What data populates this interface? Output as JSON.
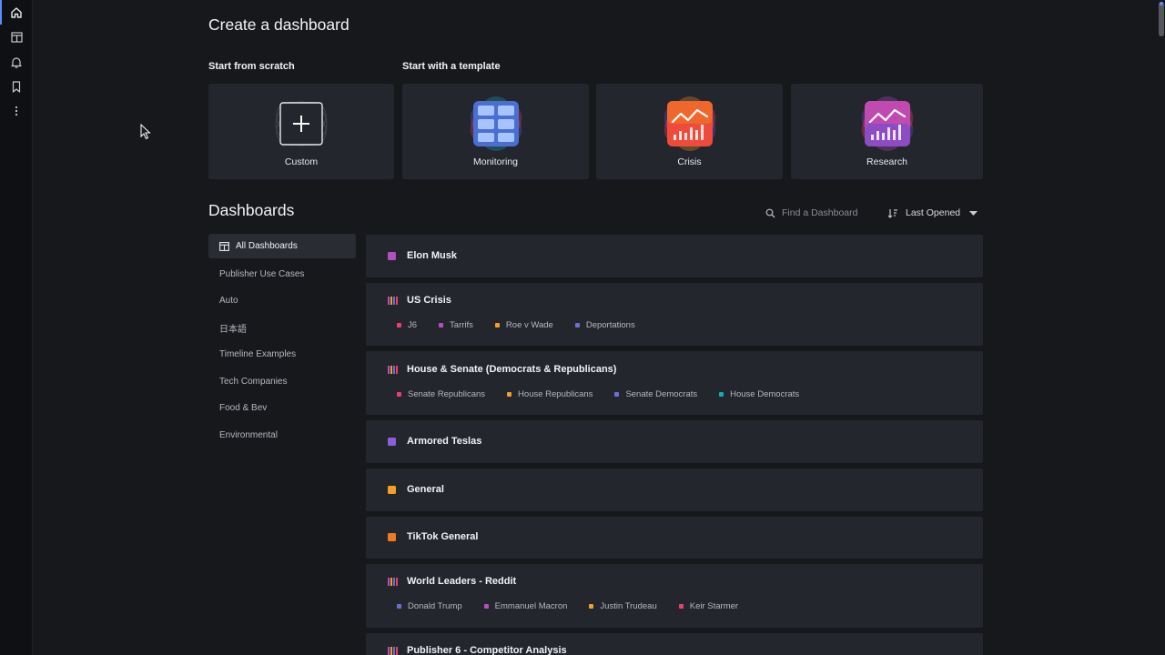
{
  "rail": {
    "icons": [
      "home-icon",
      "layout-icon",
      "bell-icon",
      "bookmark-icon",
      "more-icon"
    ]
  },
  "header": {
    "title": "Create a dashboard",
    "scratch_label": "Start from scratch",
    "template_label": "Start with a template"
  },
  "templates": [
    {
      "label": "Custom",
      "icon": "plus-icon"
    },
    {
      "label": "Monitoring",
      "icon": "grid-icon"
    },
    {
      "label": "Crisis",
      "icon": "trend-chart-icon"
    },
    {
      "label": "Research",
      "icon": "trend-chart-icon"
    }
  ],
  "dashboards": {
    "title": "Dashboards",
    "search_placeholder": "Find a Dashboard",
    "sort_label": "Last Opened"
  },
  "sidebar": {
    "items": [
      {
        "label": "All Dashboards"
      },
      {
        "label": "Publisher Use Cases"
      },
      {
        "label": "Auto"
      },
      {
        "label": "日本語"
      },
      {
        "label": "Timeline Examples"
      },
      {
        "label": "Tech Companies"
      },
      {
        "label": "Food & Bev"
      },
      {
        "label": "Environmental"
      }
    ]
  },
  "list": [
    {
      "title": "Elon Musk",
      "color": "#b44fc0",
      "multi": false,
      "tags": []
    },
    {
      "title": "US Crisis",
      "multi": true,
      "tags": [
        {
          "label": "J6",
          "color": "#e8416a"
        },
        {
          "label": "Tarrifs",
          "color": "#b44fc0"
        },
        {
          "label": "Roe v Wade",
          "color": "#f0a024"
        },
        {
          "label": "Deportations",
          "color": "#6a6fd6"
        }
      ]
    },
    {
      "title": "House & Senate (Democrats & Republicans)",
      "multi": true,
      "tags": [
        {
          "label": "Senate Republicans",
          "color": "#e8416a"
        },
        {
          "label": "House Republicans",
          "color": "#f0a024"
        },
        {
          "label": "Senate Democrats",
          "color": "#6a6fd6"
        },
        {
          "label": "House Democrats",
          "color": "#1aa7b5"
        }
      ]
    },
    {
      "title": "Armored Teslas",
      "color": "#8a5fd6",
      "multi": false,
      "tags": []
    },
    {
      "title": "General",
      "color": "#f0a024",
      "multi": false,
      "tags": []
    },
    {
      "title": "TikTok General",
      "color": "#f07a24",
      "multi": false,
      "tags": []
    },
    {
      "title": "World Leaders - Reddit",
      "multi": true,
      "tags": [
        {
          "label": "Donald Trump",
          "color": "#6a6fd6"
        },
        {
          "label": "Emmanuel Macron",
          "color": "#b44fc0"
        },
        {
          "label": "Justin Trudeau",
          "color": "#f0a024"
        },
        {
          "label": "Keir Starmer",
          "color": "#e8416a"
        }
      ]
    },
    {
      "title": "Publisher 6 - Competitor Analysis",
      "multi": true,
      "tags": []
    }
  ]
}
